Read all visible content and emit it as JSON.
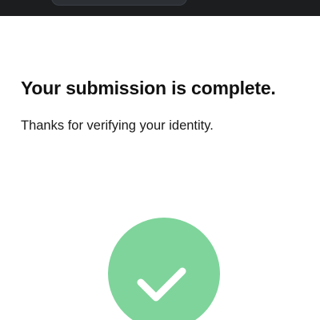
{
  "confirmation": {
    "title": "Your submission is complete.",
    "message": "Thanks for verifying your identity."
  },
  "status": {
    "icon": "check-icon",
    "color": "#7fd49b"
  }
}
